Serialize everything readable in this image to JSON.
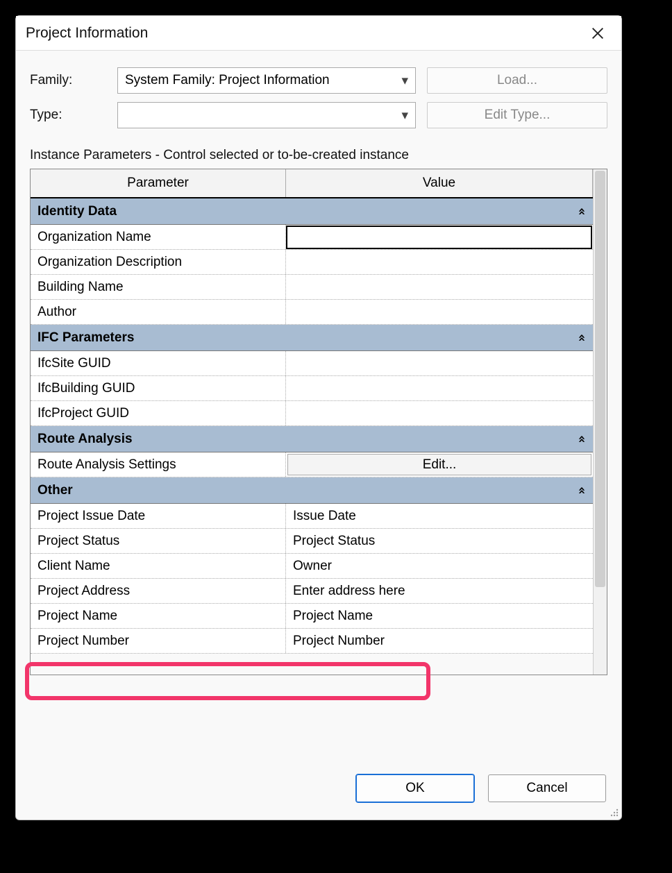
{
  "dialog": {
    "title": "Project Information"
  },
  "form": {
    "family_label": "Family:",
    "family_value": "System Family: Project Information",
    "type_label": "Type:",
    "type_value": "",
    "load_label": "Load...",
    "edit_type_label": "Edit Type...",
    "instance_label": "Instance Parameters - Control selected or to-be-created instance"
  },
  "columns": {
    "parameter": "Parameter",
    "value": "Value"
  },
  "sections": [
    {
      "title": "Identity Data",
      "rows": [
        {
          "param": "Organization Name",
          "value": "",
          "selected": true
        },
        {
          "param": "Organization Description",
          "value": ""
        },
        {
          "param": "Building Name",
          "value": ""
        },
        {
          "param": "Author",
          "value": ""
        }
      ]
    },
    {
      "title": "IFC Parameters",
      "rows": [
        {
          "param": "IfcSite GUID",
          "value": ""
        },
        {
          "param": "IfcBuilding GUID",
          "value": ""
        },
        {
          "param": "IfcProject GUID",
          "value": ""
        }
      ]
    },
    {
      "title": "Route Analysis",
      "rows": [
        {
          "param": "Route Analysis Settings",
          "value": "Edit...",
          "is_button": true
        }
      ]
    },
    {
      "title": "Other",
      "rows": [
        {
          "param": "Project Issue Date",
          "value": "Issue Date"
        },
        {
          "param": "Project Status",
          "value": "Project Status"
        },
        {
          "param": "Client Name",
          "value": "Owner"
        },
        {
          "param": "Project Address",
          "value": "Enter address here"
        },
        {
          "param": "Project Name",
          "value": "Project Name"
        },
        {
          "param": "Project Number",
          "value": "Project Number"
        }
      ]
    }
  ],
  "footer": {
    "ok": "OK",
    "cancel": "Cancel"
  }
}
